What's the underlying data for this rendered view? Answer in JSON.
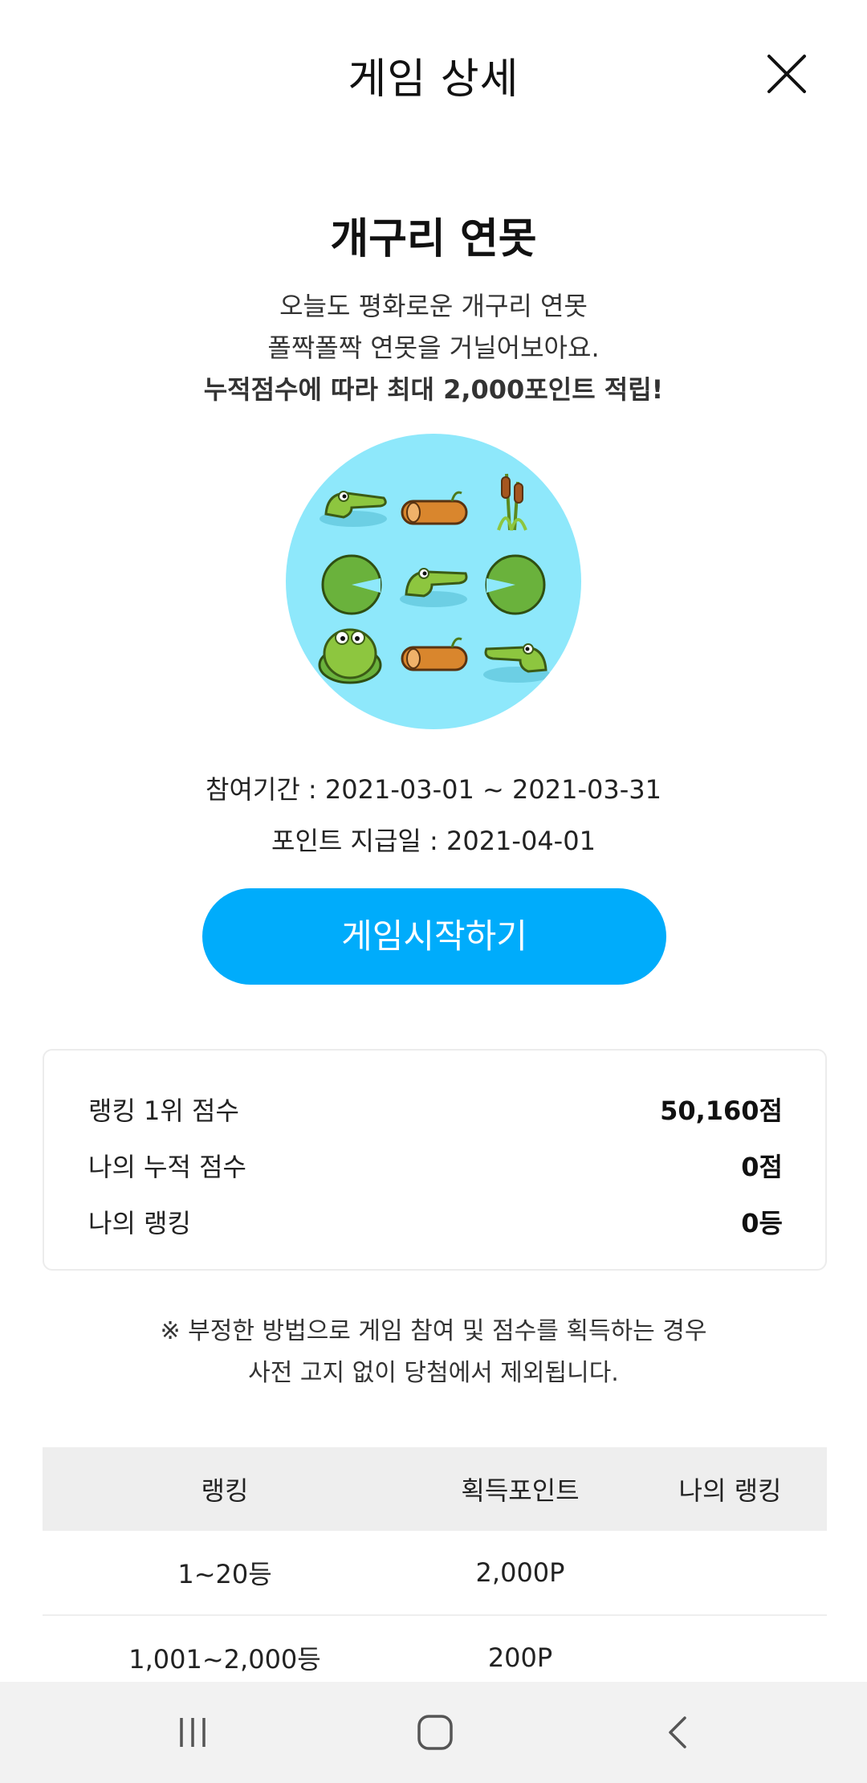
{
  "header": {
    "title": "게임 상세"
  },
  "game": {
    "title": "개구리 연못",
    "description": [
      "오늘도 평화로운 개구리 연못",
      "폴짝폴짝 연못을 거닐어보아요.",
      "누적점수에 따라 최대 2,000포인트 적립!"
    ]
  },
  "info": {
    "period": "참여기간 : 2021-03-01 ~ 2021-03-31",
    "payday": "포인트 지급일 : 2021-04-01"
  },
  "start_button": "게임시작하기",
  "stats": [
    {
      "label": "랭킹 1위 점수",
      "value": "50,160점"
    },
    {
      "label": "나의 누적 점수",
      "value": "0점"
    },
    {
      "label": "나의 랭킹",
      "value": "0등"
    }
  ],
  "notice": [
    "※ 부정한 방법으로 게임 참여 및 점수를 획득하는 경우",
    "사전 고지 없이 당첨에서 제외됩니다."
  ],
  "rank_table": {
    "headers": [
      "랭킹",
      "획득포인트",
      "나의 랭킹"
    ],
    "rows": [
      [
        "1~20등",
        "2,000P",
        ""
      ],
      [
        "1,001~2,000등",
        "200P",
        ""
      ]
    ]
  },
  "colors": {
    "accent": "#00acfb",
    "game_bg": "#8ee8fb",
    "nav_bg": "#f2f2f2"
  },
  "nav": {
    "icons": [
      "recent-apps-icon",
      "home-icon",
      "back-icon"
    ]
  }
}
